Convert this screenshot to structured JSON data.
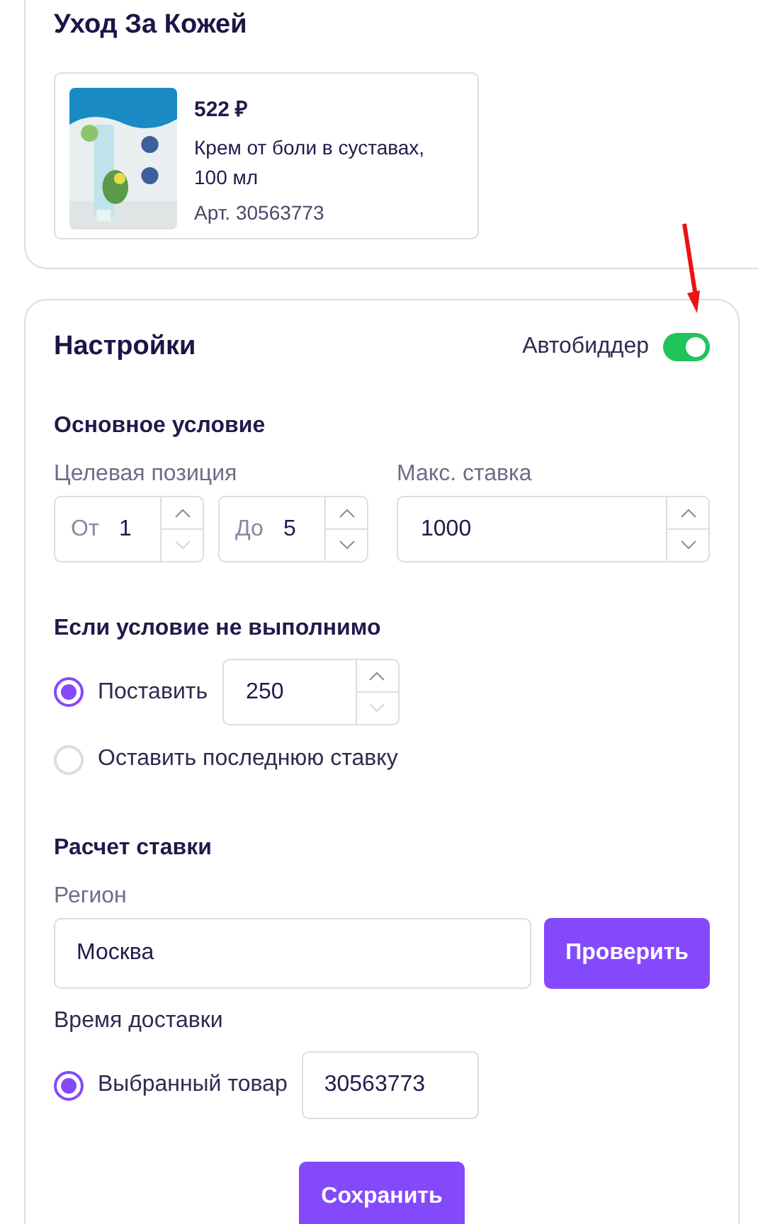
{
  "category": {
    "title": "Уход За Кожей",
    "product": {
      "price": "522 ₽",
      "name": "Крем от боли в суставах, 100 мл",
      "article": "Арт. 30563773"
    }
  },
  "settings": {
    "title": "Настройки",
    "autobidder": {
      "label": "Автобиддер",
      "on": true
    },
    "main_condition": {
      "title": "Основное условие",
      "target_label": "Целевая позиция",
      "from": {
        "prefix": "От",
        "value": "1",
        "down_disabled": true
      },
      "to": {
        "prefix": "До",
        "value": "5",
        "down_disabled": false
      },
      "max_label": "Макс. ставка",
      "max": {
        "value": "1000",
        "down_disabled": false
      }
    },
    "fallback": {
      "title": "Если условие не выполнимо",
      "options": [
        {
          "label": "Поставить",
          "selected": true,
          "value": "250",
          "down_disabled": true
        },
        {
          "label": "Оставить последнюю ставку",
          "selected": false
        }
      ]
    },
    "calc": {
      "title": "Расчет ставки",
      "region_label": "Регион",
      "region": "Москва",
      "check_button": "Проверить",
      "delivery_label": "Время доставки",
      "delivery": {
        "label": "Выбранный товар",
        "selected": true,
        "value": "30563773"
      }
    },
    "save_button": "Сохранить"
  }
}
